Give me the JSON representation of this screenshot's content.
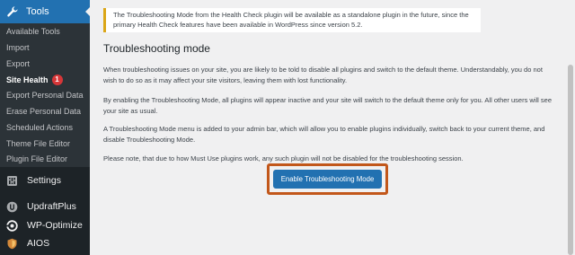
{
  "sidebar": {
    "tools_label": "Tools",
    "submenu": [
      {
        "label": "Available Tools"
      },
      {
        "label": "Import"
      },
      {
        "label": "Export"
      },
      {
        "label": "Site Health",
        "badge": "1"
      },
      {
        "label": "Export Personal Data"
      },
      {
        "label": "Erase Personal Data"
      },
      {
        "label": "Scheduled Actions"
      },
      {
        "label": "Theme File Editor"
      },
      {
        "label": "Plugin File Editor"
      }
    ],
    "menu": [
      {
        "label": "Settings",
        "icon": "settings-icon"
      },
      {
        "label": "UpdraftPlus",
        "icon": "updraftplus-icon"
      },
      {
        "label": "WP-Optimize",
        "icon": "wp-optimize-icon"
      },
      {
        "label": "AIOS",
        "icon": "aios-icon"
      }
    ]
  },
  "notice": {
    "text": "The Troubleshooting Mode from the Health Check plugin will be available as a standalone plugin in the future, since the primary Health Check features have been available in WordPress since version 5.2."
  },
  "main": {
    "heading": "Troubleshooting mode",
    "paragraphs": [
      "When troubleshooting issues on your site, you are likely to be told to disable all plugins and switch to the default theme. Understandably, you do not wish to do so as it may affect your site visitors, leaving them with lost functionality.",
      "By enabling the Troubleshooting Mode, all plugins will appear inactive and your site will switch to the default theme only for you. All other users will see your site as usual.",
      "A Troubleshooting Mode menu is added to your admin bar, which will allow you to enable plugins individually, switch back to your current theme, and disable Troubleshooting Mode.",
      "Please note, that due to how Must Use plugins work, any such plugin will not be disabled for the troubleshooting session."
    ],
    "button_label": "Enable Troubleshooting Mode"
  },
  "colors": {
    "sidebar_bg": "#1d2327",
    "submenu_bg": "#2c3338",
    "accent": "#2271b1",
    "badge": "#d63638",
    "notice_border": "#dba617",
    "highlight": "#c2571a"
  }
}
